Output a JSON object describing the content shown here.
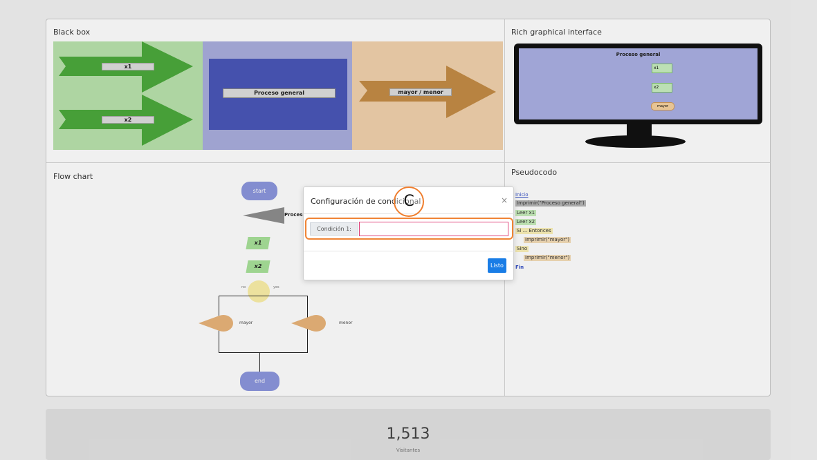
{
  "panels": {
    "black_box": {
      "title": "Black box",
      "input1": "x1",
      "input2": "x2",
      "process": "Proceso general",
      "output": "mayor / menor"
    },
    "gui": {
      "title": "Rich graphical interface",
      "screen_title": "Proceso general",
      "field1": "x1",
      "field2": "x2",
      "result_label": "mayor"
    },
    "flow_chart": {
      "title": "Flow chart",
      "start": "start",
      "process": "Proceso",
      "io1": "x1",
      "io2": "x2",
      "branch_no": "no",
      "branch_yes": "yes",
      "out_left": "mayor",
      "out_right": "menor",
      "end": "end"
    },
    "pseudocode": {
      "title": "Pseudocodo",
      "lines": [
        "Inicio",
        "Imprimir(\"Proceso general\")",
        "Leer x1",
        "Leer x2",
        "Si ... Entonces",
        "Imprimir(\"mayor\")",
        "Sino",
        "Imprimir(\"menor\")",
        "Fin"
      ]
    }
  },
  "stats": {
    "number": "1,513",
    "caption": "Visitantes"
  },
  "modal": {
    "title": "Configuración de condicional",
    "close": "×",
    "addon": "Condición 1:",
    "input_value": "",
    "input_placeholder": "",
    "button": "Listo"
  },
  "marker": "C",
  "colors": {
    "accent": "#1a7de6",
    "highlight": "#f08435",
    "invalid": "#e0467c"
  }
}
